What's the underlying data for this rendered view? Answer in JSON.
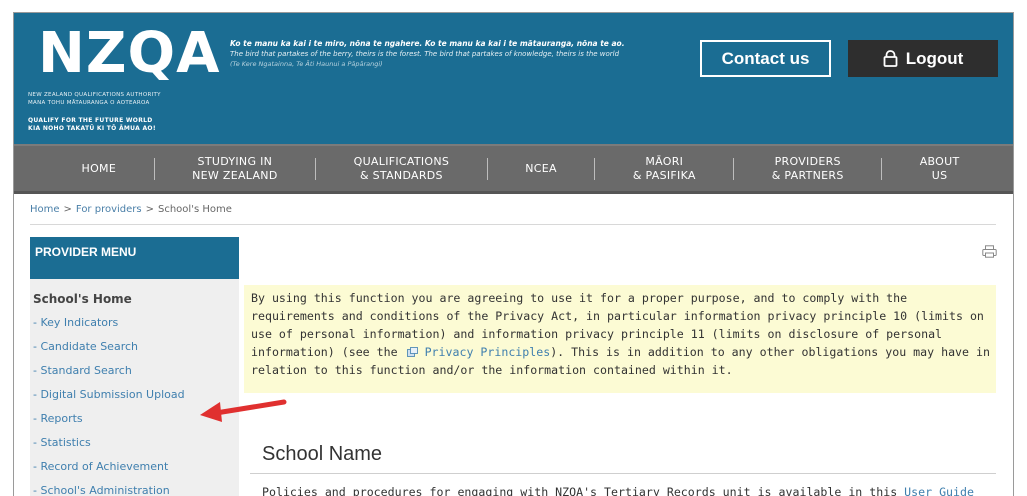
{
  "header": {
    "logo_text": "NZQA",
    "logo_sub_line1": "New Zealand Qualifications Authority",
    "logo_sub_line2": "Mana Tohu Mātauranga o Aotearoa",
    "tagline1": "QUALIFY FOR THE FUTURE WORLD",
    "tagline2": "KIA NOHO TAKATŪ KI TŌ ĀMUA AO!",
    "proverb_maori": "Ko te manu ka kai i te miro, nōna te ngahere. Ko te manu ka kai i te mātauranga, nōna te ao.",
    "proverb_english": "The bird that partakes of the berry, theirs is the forest. The bird that partakes of knowledge, theirs is the world",
    "proverb_attribution": "(Te Kere Ngatainna, Te Āti Haunui a Pāpārangi)",
    "contact_label": "Contact us",
    "logout_label": "Logout",
    "brand_color": "#1b6d93"
  },
  "nav": {
    "items": [
      {
        "line1": "HOME",
        "line2": ""
      },
      {
        "line1": "STUDYING IN",
        "line2": "NEW ZEALAND"
      },
      {
        "line1": "QUALIFICATIONS",
        "line2": "& STANDARDS"
      },
      {
        "line1": "NCEA",
        "line2": ""
      },
      {
        "line1": "MĀORI",
        "line2": "& PASIFIKA"
      },
      {
        "line1": "PROVIDERS",
        "line2": "& PARTNERS"
      },
      {
        "line1": "ABOUT",
        "line2": "US"
      }
    ]
  },
  "breadcrumb": {
    "home": "Home",
    "providers": "For providers",
    "current": "School's Home",
    "separator": ">"
  },
  "sidebar": {
    "header": "PROVIDER MENU",
    "title": "School's Home",
    "items": [
      "- Key Indicators",
      "- Candidate Search",
      "- Standard Search",
      "- Digital Submission Upload",
      "- Reports",
      "- Statistics",
      "- Record of Achievement",
      "- School's Administration"
    ]
  },
  "notice": {
    "part1": "By using this function you are agreeing to use it for a proper purpose, and to comply with the requirements and conditions of the Privacy Act, in particular information privacy principle 10 (limits on use of personal information) and information privacy principle 11 (limits on disclosure of personal information) (see the",
    "link": "Privacy Principles",
    "part2": "). This is in addition to any other obligations you may have in relation to this function and/or the information contained within it."
  },
  "main": {
    "school_name": "School Name",
    "policies_text": "Policies and procedures for engaging with NZQA's Tertiary Records unit is available in this",
    "policies_link": "User Guide"
  },
  "icons": {
    "print": "print-icon",
    "logout": "lock-icon",
    "external": "external-link-icon",
    "annotation": "red-arrow-icon"
  },
  "colors": {
    "link": "#3f7fae",
    "nav_bg": "#6a6a6a",
    "notice_bg": "#fcfbd4",
    "arrow": "#e0302f"
  }
}
